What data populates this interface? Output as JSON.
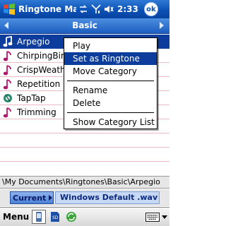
{
  "titlebar": {
    "title": "Ringtone Ma",
    "time": "2:33",
    "ok_label": "ok",
    "icons": [
      "start-logo-icon",
      "connectivity-icon",
      "signal-icon",
      "volume-icon"
    ]
  },
  "category": {
    "name": "Basic"
  },
  "list": {
    "items": [
      {
        "label": "Arpegio",
        "icon": "music-note-icon"
      },
      {
        "label": "ChirpingBird",
        "icon": "music-note-icon"
      },
      {
        "label": "CrispWeather",
        "icon": "music-note-icon"
      },
      {
        "label": "Repetition",
        "icon": "music-note-icon"
      },
      {
        "label": "TapTap",
        "icon": "audio-file-icon"
      },
      {
        "label": "Trimming",
        "icon": "music-note-icon"
      }
    ]
  },
  "context_menu": {
    "items": [
      {
        "label": "Play"
      },
      {
        "label": "Set as Ringtone"
      },
      {
        "label": "Move Category"
      },
      {
        "label": "Rename"
      },
      {
        "label": "Delete"
      },
      {
        "label": "Show Category List"
      }
    ]
  },
  "path": "\\My Documents\\Ringtones\\Basic\\Arpegio",
  "current": {
    "button_label": "Current",
    "value": "Windows Default .wav"
  },
  "menubar": {
    "menu_label": "Menu"
  },
  "colors": {
    "title_blue": "#0a4fb3",
    "selection": "#0c3c9c",
    "note_magenta": "#b0186e",
    "row_line": "#e8bcc4"
  }
}
